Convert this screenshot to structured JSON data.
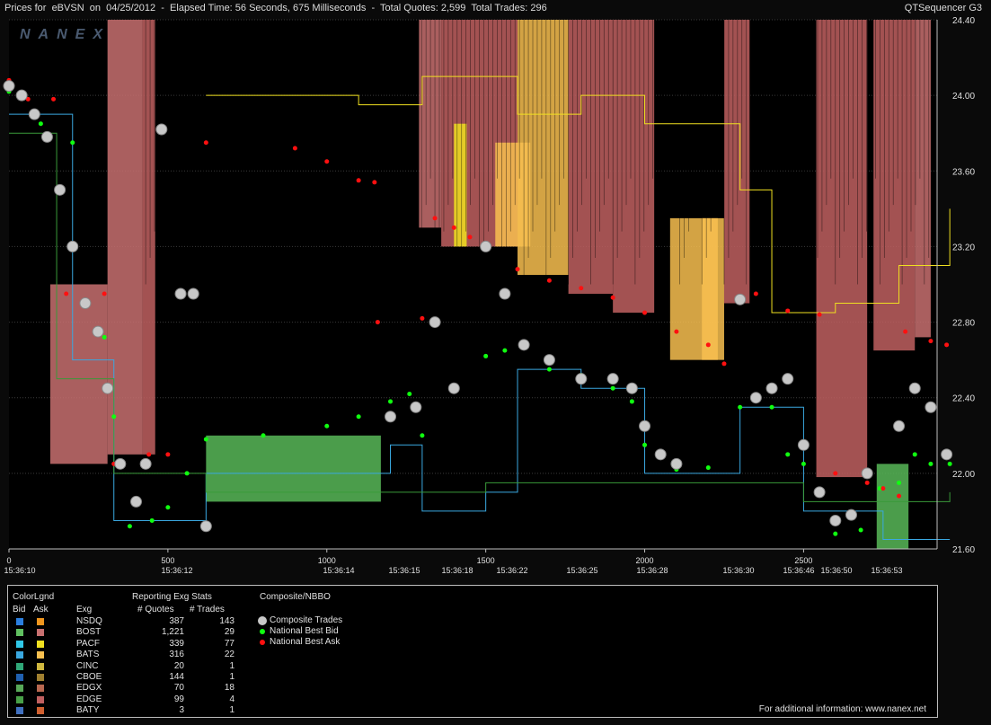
{
  "header": {
    "title": "Prices for  eBVSN  on  04/25/2012  -  Elapsed Time: 56 Seconds, 675 Milliseconds  -  Total Quotes: 2,599  Total Trades: 296",
    "app_name": "QTSequencer G3",
    "watermark": "NANEX"
  },
  "chart_data": {
    "type": "scatter",
    "x_axis_numbers": [
      "0",
      "500",
      "1000",
      "1500",
      "2000",
      "2500"
    ],
    "x_axis_times": [
      "15:36:10",
      "15:36:12",
      "15:36:14",
      "15:36:15",
      "15:36:18",
      "15:36:22",
      "15:36:25",
      "15:36:28",
      "15:36:30",
      "15:36:46",
      "15:36:50",
      "15:36:53"
    ],
    "y_ticks": [
      "24.40",
      "24.00",
      "23.60",
      "23.20",
      "22.80",
      "22.40",
      "22.00",
      "21.60"
    ],
    "ylim": [
      21.6,
      24.4
    ],
    "xlim": [
      0,
      2920
    ],
    "grid": true,
    "national_best_ask": [
      [
        0,
        24.08
      ],
      [
        60,
        23.98
      ],
      [
        140,
        23.98
      ],
      [
        180,
        22.95
      ],
      [
        300,
        22.95
      ],
      [
        330,
        22.05
      ],
      [
        420,
        22.05
      ],
      [
        440,
        22.1
      ],
      [
        500,
        22.1
      ],
      [
        620,
        23.75
      ],
      [
        900,
        23.72
      ],
      [
        1000,
        23.65
      ],
      [
        1100,
        23.55
      ],
      [
        1150,
        23.54
      ],
      [
        1160,
        22.8
      ],
      [
        1300,
        22.82
      ],
      [
        1340,
        23.35
      ],
      [
        1400,
        23.3
      ],
      [
        1450,
        23.25
      ],
      [
        1500,
        23.2
      ],
      [
        1600,
        23.08
      ],
      [
        1700,
        23.02
      ],
      [
        1800,
        22.98
      ],
      [
        1900,
        22.93
      ],
      [
        2000,
        22.85
      ],
      [
        2100,
        22.75
      ],
      [
        2200,
        22.68
      ],
      [
        2250,
        22.58
      ],
      [
        2350,
        22.95
      ],
      [
        2450,
        22.86
      ],
      [
        2550,
        22.84
      ],
      [
        2600,
        22.0
      ],
      [
        2700,
        21.95
      ],
      [
        2750,
        21.92
      ],
      [
        2800,
        21.88
      ],
      [
        2820,
        22.75
      ],
      [
        2900,
        22.7
      ],
      [
        2950,
        22.68
      ]
    ],
    "national_best_bid": [
      [
        0,
        24.02
      ],
      [
        100,
        23.85
      ],
      [
        200,
        23.75
      ],
      [
        300,
        22.72
      ],
      [
        330,
        22.3
      ],
      [
        380,
        21.72
      ],
      [
        450,
        21.75
      ],
      [
        500,
        21.82
      ],
      [
        560,
        22.0
      ],
      [
        620,
        22.18
      ],
      [
        800,
        22.2
      ],
      [
        1000,
        22.25
      ],
      [
        1100,
        22.3
      ],
      [
        1200,
        22.38
      ],
      [
        1260,
        22.42
      ],
      [
        1300,
        22.2
      ],
      [
        1400,
        22.45
      ],
      [
        1500,
        22.62
      ],
      [
        1560,
        22.65
      ],
      [
        1700,
        22.55
      ],
      [
        1800,
        22.52
      ],
      [
        1900,
        22.45
      ],
      [
        1960,
        22.38
      ],
      [
        2000,
        22.15
      ],
      [
        2100,
        22.02
      ],
      [
        2200,
        22.03
      ],
      [
        2300,
        22.35
      ],
      [
        2400,
        22.35
      ],
      [
        2450,
        22.1
      ],
      [
        2500,
        22.05
      ],
      [
        2600,
        21.68
      ],
      [
        2680,
        21.7
      ],
      [
        2740,
        21.92
      ],
      [
        2800,
        21.95
      ],
      [
        2850,
        22.1
      ],
      [
        2900,
        22.05
      ],
      [
        2960,
        22.05
      ]
    ],
    "composite_trades": [
      [
        0,
        24.05
      ],
      [
        40,
        24.0
      ],
      [
        80,
        23.9
      ],
      [
        120,
        23.78
      ],
      [
        160,
        23.5
      ],
      [
        200,
        23.2
      ],
      [
        240,
        22.9
      ],
      [
        280,
        22.75
      ],
      [
        310,
        22.45
      ],
      [
        350,
        22.05
      ],
      [
        400,
        21.85
      ],
      [
        430,
        22.05
      ],
      [
        480,
        23.82
      ],
      [
        540,
        22.95
      ],
      [
        580,
        22.95
      ],
      [
        620,
        21.72
      ],
      [
        1200,
        22.3
      ],
      [
        1280,
        22.35
      ],
      [
        1340,
        22.8
      ],
      [
        1400,
        22.45
      ],
      [
        1500,
        23.2
      ],
      [
        1560,
        22.95
      ],
      [
        1620,
        22.68
      ],
      [
        1700,
        22.6
      ],
      [
        1800,
        22.5
      ],
      [
        1900,
        22.5
      ],
      [
        1960,
        22.45
      ],
      [
        2000,
        22.25
      ],
      [
        2050,
        22.1
      ],
      [
        2100,
        22.05
      ],
      [
        2300,
        22.92
      ],
      [
        2350,
        22.4
      ],
      [
        2400,
        22.45
      ],
      [
        2450,
        22.5
      ],
      [
        2500,
        22.15
      ],
      [
        2550,
        21.9
      ],
      [
        2600,
        21.75
      ],
      [
        2650,
        21.78
      ],
      [
        2700,
        22.0
      ],
      [
        2800,
        22.25
      ],
      [
        2850,
        22.45
      ],
      [
        2900,
        22.35
      ],
      [
        2950,
        22.1
      ]
    ],
    "legend": [
      "Composite Trades",
      "National Best Bid",
      "National Best Ask"
    ]
  },
  "legend_panel": {
    "color_legend_title": "ColorLgnd",
    "bid_label": "Bid",
    "ask_label": "Ask",
    "stats_title": "Reporting Exg Stats",
    "exg_col": "Exg",
    "quotes_col": "# Quotes",
    "trades_col": "# Trades",
    "composite_title": "Composite/NBBO",
    "exchanges": [
      {
        "name": "NSDQ",
        "quotes": "387",
        "trades": "143",
        "bid_color": "#2b7fe0",
        "ask_color": "#f0961e"
      },
      {
        "name": "BOST",
        "quotes": "1,221",
        "trades": "29",
        "bid_color": "#60c060",
        "ask_color": "#c87070"
      },
      {
        "name": "PACF",
        "quotes": "339",
        "trades": "77",
        "bid_color": "#30c8e8",
        "ask_color": "#f0e020"
      },
      {
        "name": "BATS",
        "quotes": "316",
        "trades": "22",
        "bid_color": "#3aa8e0",
        "ask_color": "#f8c050"
      },
      {
        "name": "CINC",
        "quotes": "20",
        "trades": "1",
        "bid_color": "#30a878",
        "ask_color": "#d0b840"
      },
      {
        "name": "CBOE",
        "quotes": "144",
        "trades": "1",
        "bid_color": "#2060b0",
        "ask_color": "#a08030"
      },
      {
        "name": "EDGX",
        "quotes": "70",
        "trades": "18",
        "bid_color": "#58a858",
        "ask_color": "#b86850"
      },
      {
        "name": "EDGE",
        "quotes": "99",
        "trades": "4",
        "bid_color": "#48a048",
        "ask_color": "#c06060"
      },
      {
        "name": "BATY",
        "quotes": "3",
        "trades": "1",
        "bid_color": "#4070c0",
        "ask_color": "#d06030"
      }
    ],
    "composite_items": [
      {
        "label": "Composite Trades",
        "color": "#c8c8c8"
      },
      {
        "label": "National Best Bid",
        "color": "#10ff10"
      },
      {
        "label": "National Best Ask",
        "color": "#ff1010"
      }
    ],
    "footer": "For additional information: www.nanex.net"
  }
}
